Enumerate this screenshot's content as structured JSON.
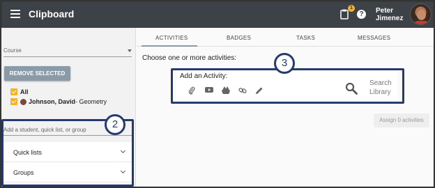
{
  "header": {
    "title": "Clipboard",
    "notification_count": "1",
    "help_glyph": "?",
    "user_first": "Peter",
    "user_last": "Jimenez",
    "bar_color": "#3c4247",
    "badge_color": "#f5b324"
  },
  "sidebar": {
    "course_placeholder": "Course",
    "remove_button": "REMOVE SELECTED",
    "checks": [
      {
        "label": "All",
        "suffix": ""
      },
      {
        "label": "Johnson, David",
        "suffix": " - Geometry"
      }
    ],
    "add_student_placeholder": "Add a student, quick list, or group",
    "groups": [
      "Quick lists",
      "Groups"
    ]
  },
  "tabs": [
    "ACTIVITIES",
    "BADGES",
    "TASKS",
    "MESSAGES"
  ],
  "main": {
    "choose_label": "Choose one or more activities:",
    "add_activity_title": "Add an Activity:",
    "activity_icons": [
      "paperclip-icon",
      "youtube-icon",
      "google-drive-icon",
      "link-icon",
      "pencil-icon"
    ],
    "search_line1": "Search",
    "search_line2": "Library",
    "assign_button": "Assign 0 activities"
  },
  "annotations": {
    "left": "2",
    "right": "3",
    "color": "#253a6e"
  }
}
